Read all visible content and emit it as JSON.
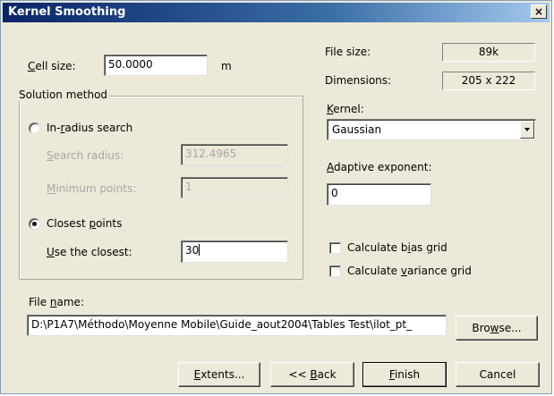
{
  "window": {
    "title": "Kernel Smoothing",
    "close_label": "×"
  },
  "cell_size": {
    "label_pre": "",
    "label_key": "C",
    "label_post": "ell size:",
    "value": "50.0000",
    "unit": "m"
  },
  "solution_method": {
    "title": "Solution method",
    "in_radius": {
      "label_pre": "In-",
      "label_key": "r",
      "label_post": "adius search",
      "selected": false
    },
    "search_radius": {
      "label_key": "S",
      "label_post": "earch radius:",
      "value": "312.4965",
      "enabled": false
    },
    "minimum_points": {
      "label_key": "M",
      "label_post": "inimum points:",
      "value": "1",
      "enabled": false
    },
    "closest_points": {
      "label_pre": "Closest ",
      "label_key": "p",
      "label_post": "oints",
      "selected": true
    },
    "use_closest": {
      "label_key": "U",
      "label_post": "se the closest:",
      "value": "30"
    }
  },
  "file_info": {
    "size_label": "File size:",
    "size_value": "89k",
    "dims_label": "Dimensions:",
    "dims_value": "205 x 222"
  },
  "kernel": {
    "label_key": "K",
    "label_post": "ernel:",
    "value": "Gaussian"
  },
  "adaptive_exponent": {
    "label_key": "A",
    "label_post": "daptive exponent:",
    "value": "0"
  },
  "bias_grid": {
    "label_pre": "Calculate b",
    "label_key": "i",
    "label_post": "as grid",
    "checked": false
  },
  "variance_grid": {
    "label_pre": "Calculate ",
    "label_key": "v",
    "label_post": "ariance grid",
    "checked": false
  },
  "file_name": {
    "label_pre": "File ",
    "label_key": "n",
    "label_post": "ame:",
    "value": "D:\\P1A7\\Méthodo\\Moyenne Mobile\\Guide_aout2004\\Tables Test\\ilot_pt_"
  },
  "buttons": {
    "browse": {
      "pre": "Bro",
      "key": "w",
      "post": "se..."
    },
    "extents": {
      "pre": "",
      "key": "E",
      "post": "xtents..."
    },
    "back": {
      "pre": "<< ",
      "key": "B",
      "post": "ack"
    },
    "finish": {
      "pre": "",
      "key": "F",
      "post": "inish"
    },
    "cancel": {
      "pre": "",
      "key": "",
      "post": "Cancel"
    }
  }
}
